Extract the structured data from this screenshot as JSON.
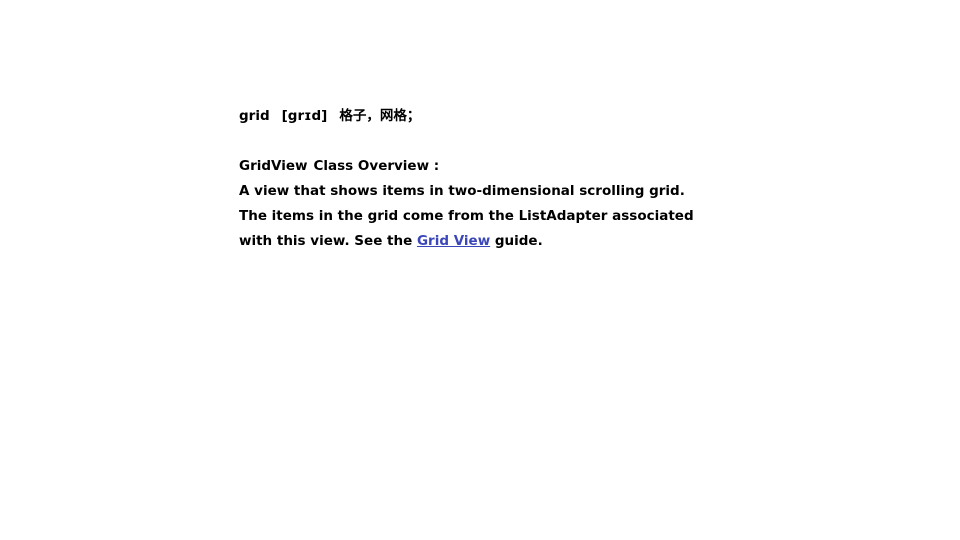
{
  "vocab": {
    "word": "grid",
    "phonetic": "[grɪd]",
    "meaning": "格子，网格；"
  },
  "overview": {
    "class_name": "GridView",
    "heading": "Class Overview :",
    "line1": "A view that shows items in two-dimensional scrolling grid.",
    "line2": "The items in the grid come from the ListAdapter associated",
    "line3_before": "with this view. See the ",
    "link_text": "Grid View",
    "line3_after": " guide."
  },
  "colors": {
    "text": "#000000",
    "link": "#3b46b8",
    "background": "#ffffff"
  }
}
